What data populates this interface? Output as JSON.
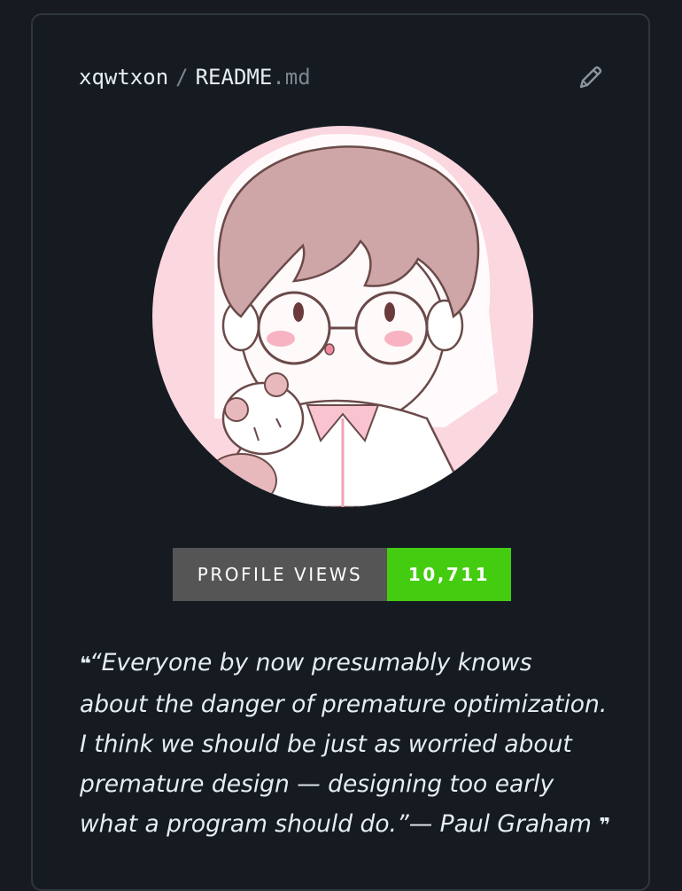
{
  "header": {
    "user": "xqwtxon",
    "separator": "/",
    "file_name": "README",
    "file_ext": ".md"
  },
  "badge": {
    "label": "PROFILE VIEWS",
    "value": "10,711",
    "label_color": "#555555",
    "value_color": "#44cc11"
  },
  "quote": {
    "open_mark": "❝",
    "lines": [
      "“Everyone by now presumably knows",
      "about the danger of premature optimization.",
      "I think we should be just as worried about",
      "premature design — designing too early",
      "what a program should do.”— Paul Graham"
    ],
    "close_mark": "❞"
  },
  "icons": {
    "edit": "pencil-icon",
    "avatar": "anime-avatar"
  }
}
